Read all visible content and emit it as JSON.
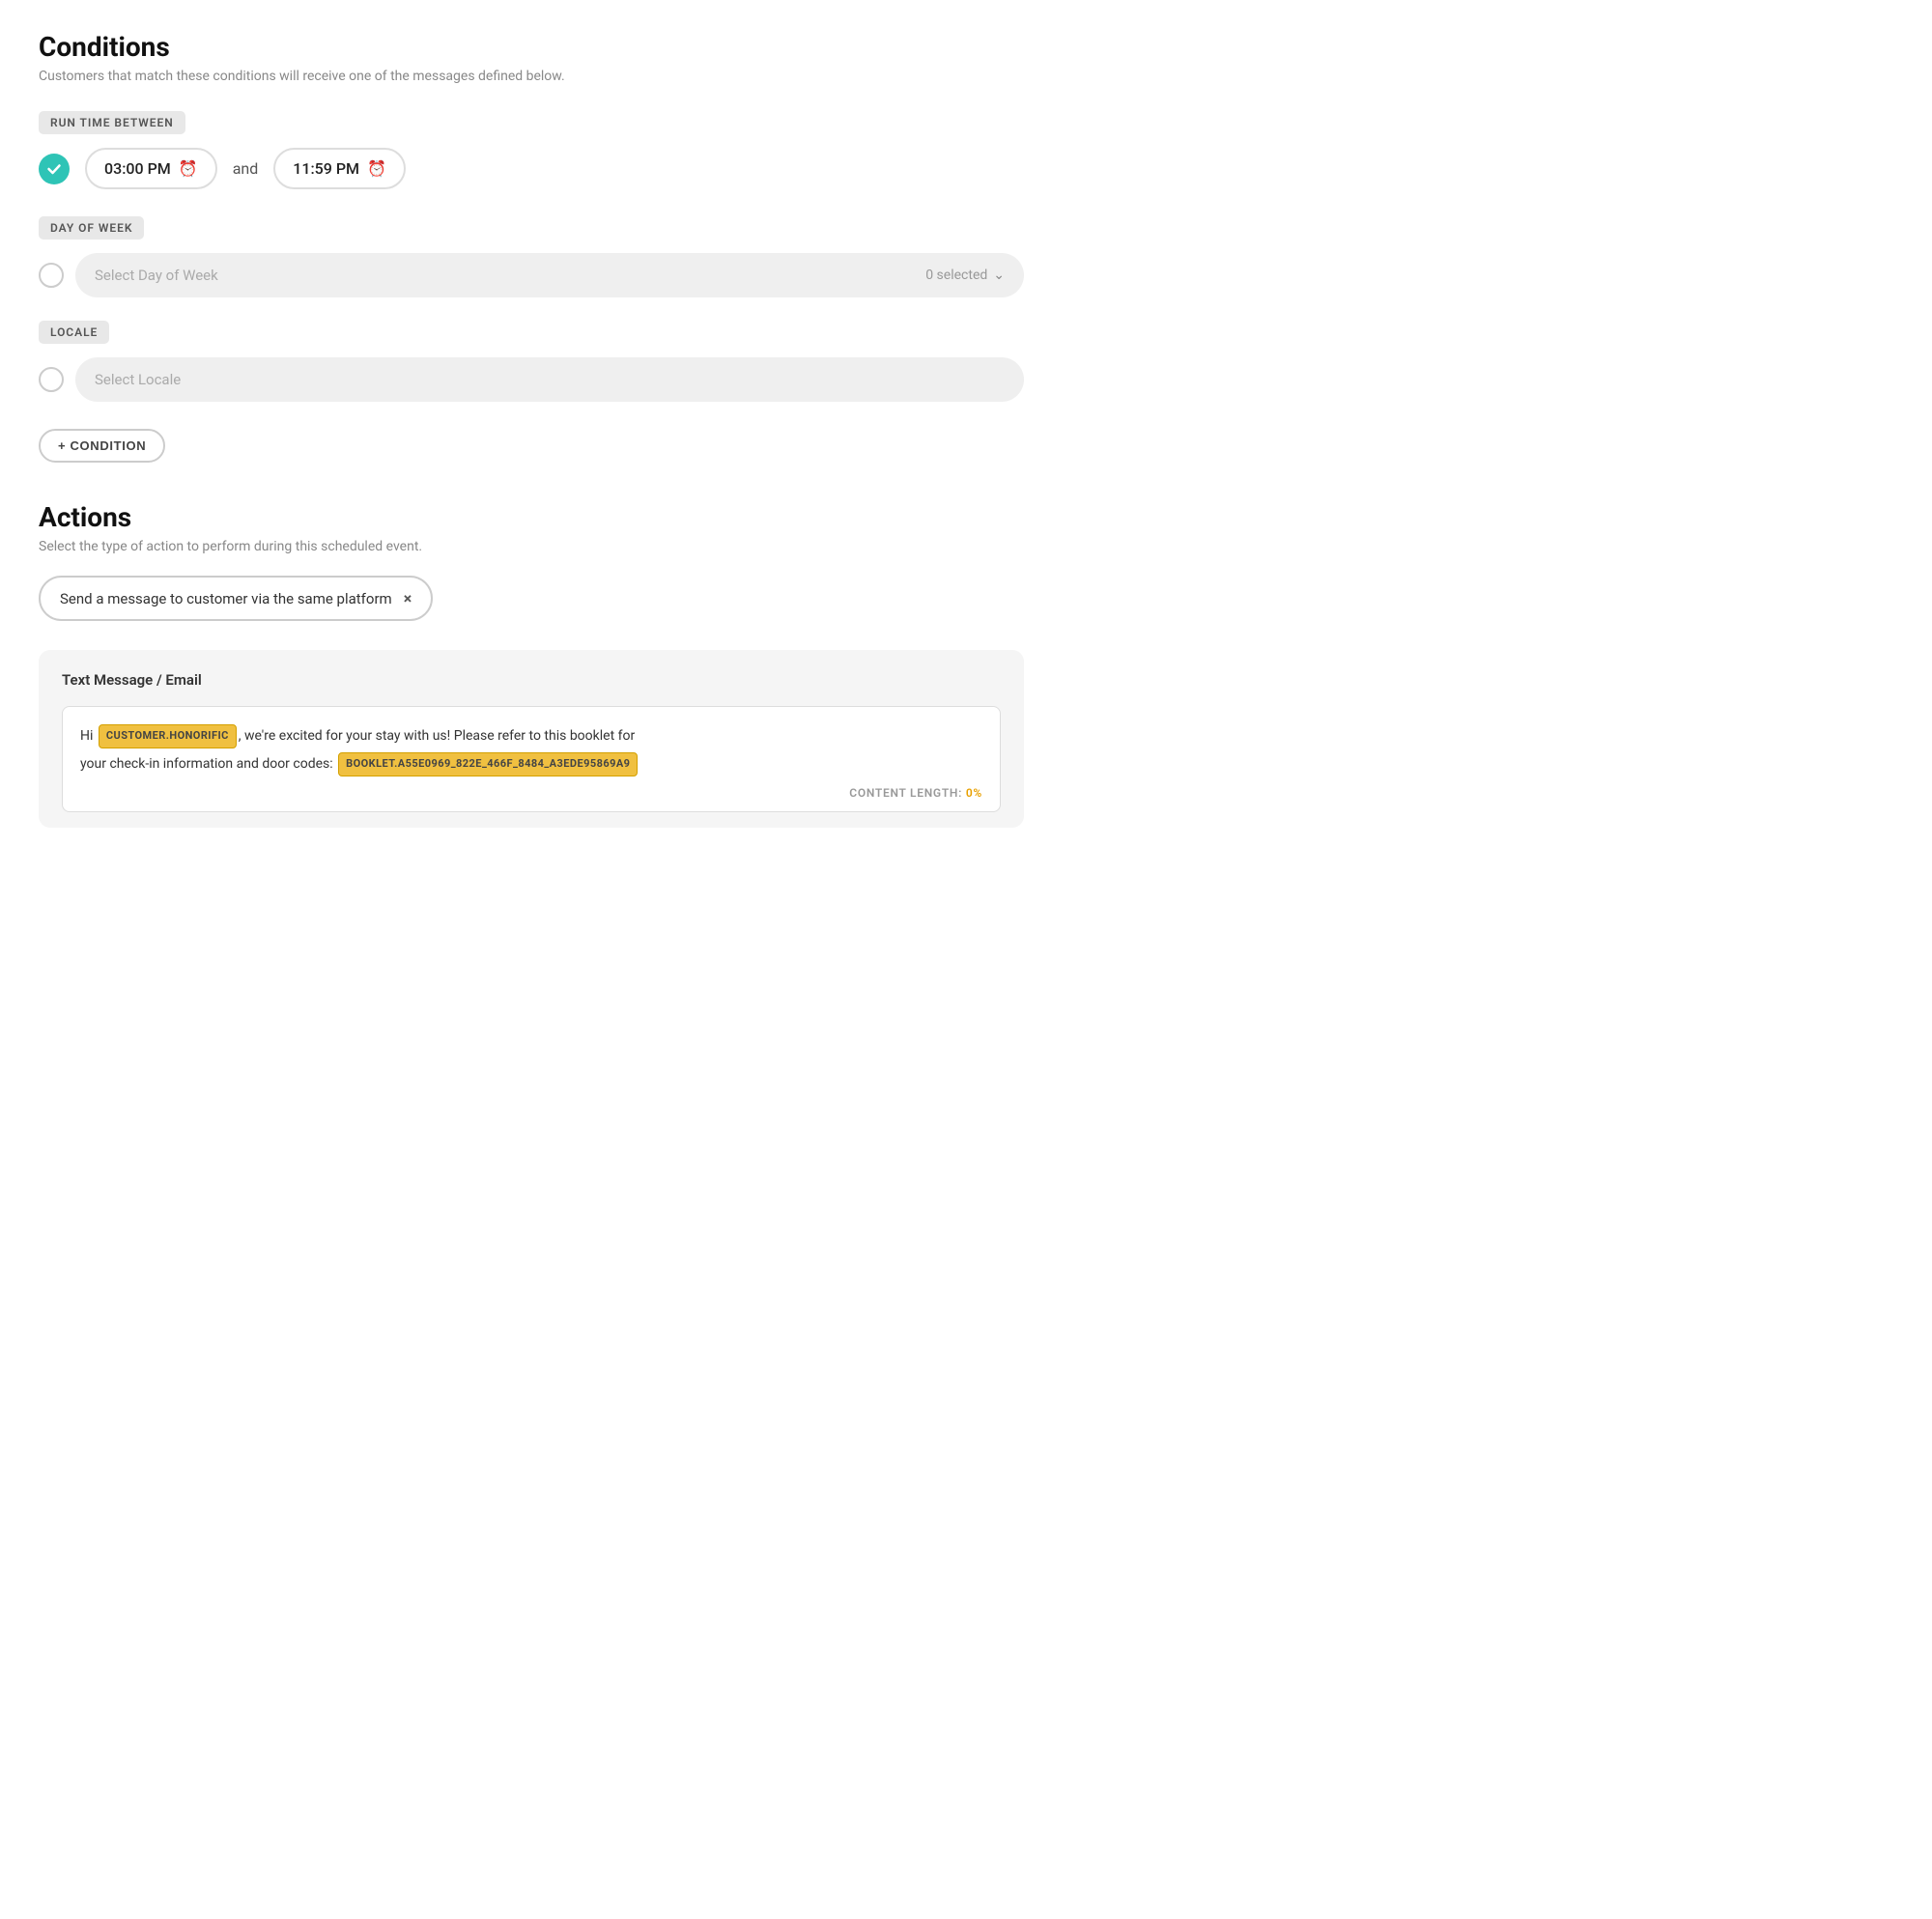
{
  "conditions": {
    "title": "Conditions",
    "subtitle": "Customers that match these conditions will receive one of the messages defined below.",
    "run_time_label": "RUN TIME BETWEEN",
    "time_start": "03:00 PM",
    "time_end": "11:59 PM",
    "and_text": "and",
    "day_of_week_label": "DAY OF WEEK",
    "day_of_week_placeholder": "Select Day of Week",
    "day_of_week_count": "0 selected",
    "locale_label": "LOCALE",
    "locale_placeholder": "Select Locale",
    "add_condition_label": "+ CONDITION"
  },
  "actions": {
    "title": "Actions",
    "subtitle": "Select the type of action to perform during this scheduled event.",
    "action_tag_text": "Send a message to customer via the same platform",
    "action_tag_close": "×"
  },
  "message_box": {
    "title": "Text Message / Email",
    "text_before_tag1": "Hi ",
    "tag1": "CUSTOMER.HONORIFIC",
    "text_after_tag1": ", we're excited for your stay with us! Please refer to this booklet for",
    "text_line2_before": "your check-in information and door codes: ",
    "tag2": "BOOKLET.A55E0969_822E_466F_8484_A3EDE95869A9",
    "content_length_label": "CONTENT LENGTH:",
    "content_length_value": "0%"
  }
}
